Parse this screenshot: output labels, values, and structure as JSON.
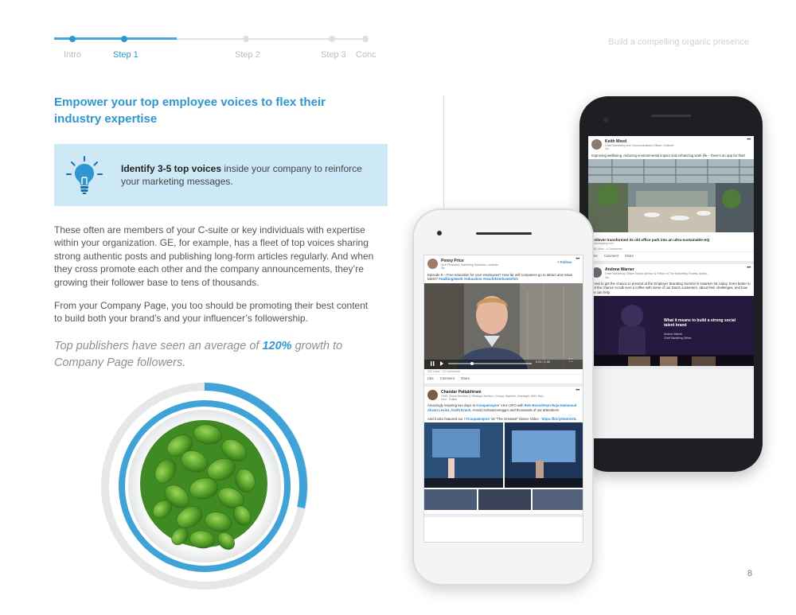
{
  "nav": {
    "steps": [
      "Intro",
      "Step 1",
      "Step 2",
      "Step 3",
      "Conc"
    ],
    "active_step": 1
  },
  "header": {
    "section_title": "Build a compelling organic presence"
  },
  "headline": "Empower your top employee voices to flex their industry expertise",
  "callout": {
    "bold": "Identify 3-5 top voices",
    "rest": " inside your company to reinforce your marketing messages."
  },
  "body": {
    "p1": "These often are members of your C-suite or key individuals with expertise within your organization. GE, for example, has a fleet of top voices sharing strong authentic posts and publishing long-form articles regularly. And when they cross promote each other and the company announcements, they’re growing their follower base to tens of thousands.",
    "p2": "From your Company Page, you too should be promoting their best content to build both your brand’s and your influencer’s followership."
  },
  "quote": {
    "before": "Top publishers have seen an average of ",
    "highlight": "120%",
    "after": " growth to Company Page followers."
  },
  "page_number": "8",
  "phone_back": {
    "post1": {
      "name": "Keith Weed",
      "title": "Chief Marketing and Communications Officer, Unilever",
      "time": "2w",
      "text": "Improving wellbeing, reducing environmental impact and enhancing work life – there’s an app for that!",
      "link_title": "Unilever transformed its old office park into an ultra-sustainable HQ",
      "link_url": "fastcompany.com",
      "stats": "166 Likes · 4 Comments",
      "actions": [
        "Like",
        "Comment",
        "Share"
      ]
    },
    "post2": {
      "name": "Andrew Warner",
      "title": "Chief Marketing Officer, Board Advisor & Fellow of The Marketing Society, Availa...",
      "time": "3w",
      "text": "Great to get the chance to present at the Employer Branding Summit in Haarlem NL today. Even better to get the chance to talk over a coffee with some of our Dutch customers, about their challenges, and how we can help.",
      "slide_title": "What it means to build a strong social talent brand",
      "slide_name": "Andrew Warner",
      "slide_role": "Chief Marketing Officer"
    }
  },
  "phone_front": {
    "post1": {
      "name": "Penny Price",
      "title": "Vice President, Marketing Solutions, LinkedIn",
      "time": "2w",
      "follow": "+ Follow",
      "text": "Episode 6 – Free education for your employees? How far will companies go to attract and retain talent?",
      "tags": "#walking2work #education #teachthemhowtofish",
      "video_time": "0:23 / 1:30",
      "stats": "234 Likes · 22 Comments",
      "actions": [
        "Like",
        "Comment",
        "Share"
      ]
    },
    "post2": {
      "name": "Chandar Pattabhiram",
      "title": "CMO, Board Member & Strategic Advisor | Coupa, Marketo, Gainsight, IBM, Bad...",
      "time": "3mo · Edited",
      "text1": "Amazingly inspiring two days at",
      "tag1": "#coupainspire",
      "text2": " '18 in SFO with",
      "people": "Rob Bernshteyn Raja Hammoud Alivan Levine,  Keith Krach,",
      "text3": " Arnold Schwarzenegger and thousands of our attendees!",
      "text4": "And it also featured our !",
      "tag2": "#CoupaInspire",
      "text5": " '18 \"The Greatest\" Dance Video",
      "link": "- https://bit.ly/2wtoXOL"
    }
  },
  "colors": {
    "accent": "#2f96cf",
    "callout_bg": "#cde9f6",
    "ring": "#3fa3d8"
  }
}
